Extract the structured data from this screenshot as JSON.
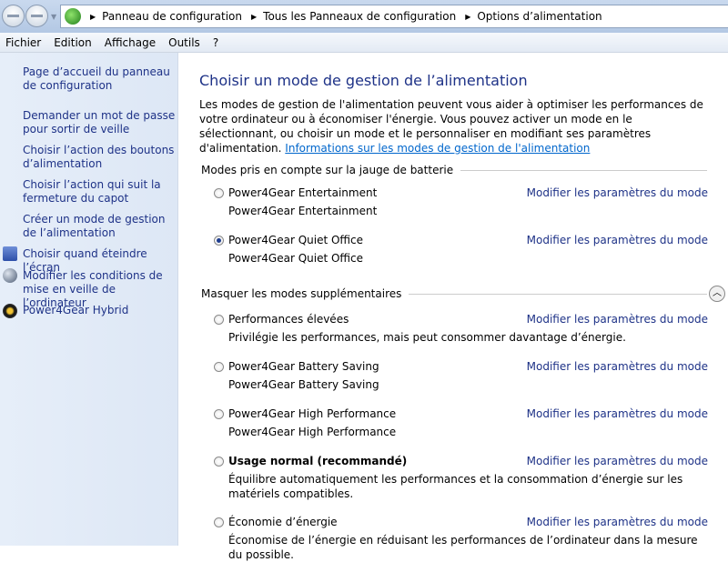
{
  "breadcrumb": [
    "Panneau de configuration",
    "Tous les Panneaux de configuration",
    "Options d’alimentation"
  ],
  "menu": [
    "Fichier",
    "Edition",
    "Affichage",
    "Outils",
    "?"
  ],
  "sidebar": {
    "items": [
      "Page d’accueil du panneau de configuration",
      "Demander un mot de passe pour sortir de veille",
      "Choisir l’action des boutons d’alimentation",
      "Choisir l’action qui suit la fermeture du capot",
      "Créer un mode de gestion de l’alimentation",
      "Choisir quand éteindre l’écran",
      "Modifier les conditions de mise en veille de l’ordinateur",
      "Power4Gear Hybrid"
    ]
  },
  "main": {
    "title": "Choisir un mode de gestion de l’alimentation",
    "intro": "Les modes de gestion de l'alimentation peuvent vous aider à optimiser les performances de votre ordinateur ou à économiser l'énergie. Vous pouvez activer un mode en le sélectionnant, ou choisir un mode et le personnaliser en modifiant ses paramètres d'alimentation. ",
    "intro_link": "Informations sur les modes de gestion de l'alimentation",
    "section1": "Modes pris en compte sur la jauge de batterie",
    "section2": "Masquer les modes supplémentaires",
    "modify": "Modifier les paramètres du mode",
    "plans": [
      {
        "name": "Power4Gear Entertainment",
        "desc": "Power4Gear Entertainment",
        "selected": false
      },
      {
        "name": "Power4Gear Quiet Office",
        "desc": "Power4Gear Quiet Office",
        "selected": true
      },
      {
        "name": "Performances élevées",
        "desc": "Privilégie les performances, mais peut consommer davantage d’énergie.",
        "selected": false
      },
      {
        "name": "Power4Gear Battery Saving",
        "desc": "Power4Gear Battery Saving",
        "selected": false
      },
      {
        "name": "Power4Gear High Performance",
        "desc": "Power4Gear High Performance",
        "selected": false
      },
      {
        "name": "Usage normal (recommandé)",
        "desc": "Équilibre automatiquement les performances et la consommation d’énergie sur les matériels compatibles.",
        "selected": false
      },
      {
        "name": "Économie d’énergie",
        "desc": "Économise de l’énergie en réduisant les performances de l’ordinateur dans la mesure du possible.",
        "selected": false
      }
    ]
  }
}
